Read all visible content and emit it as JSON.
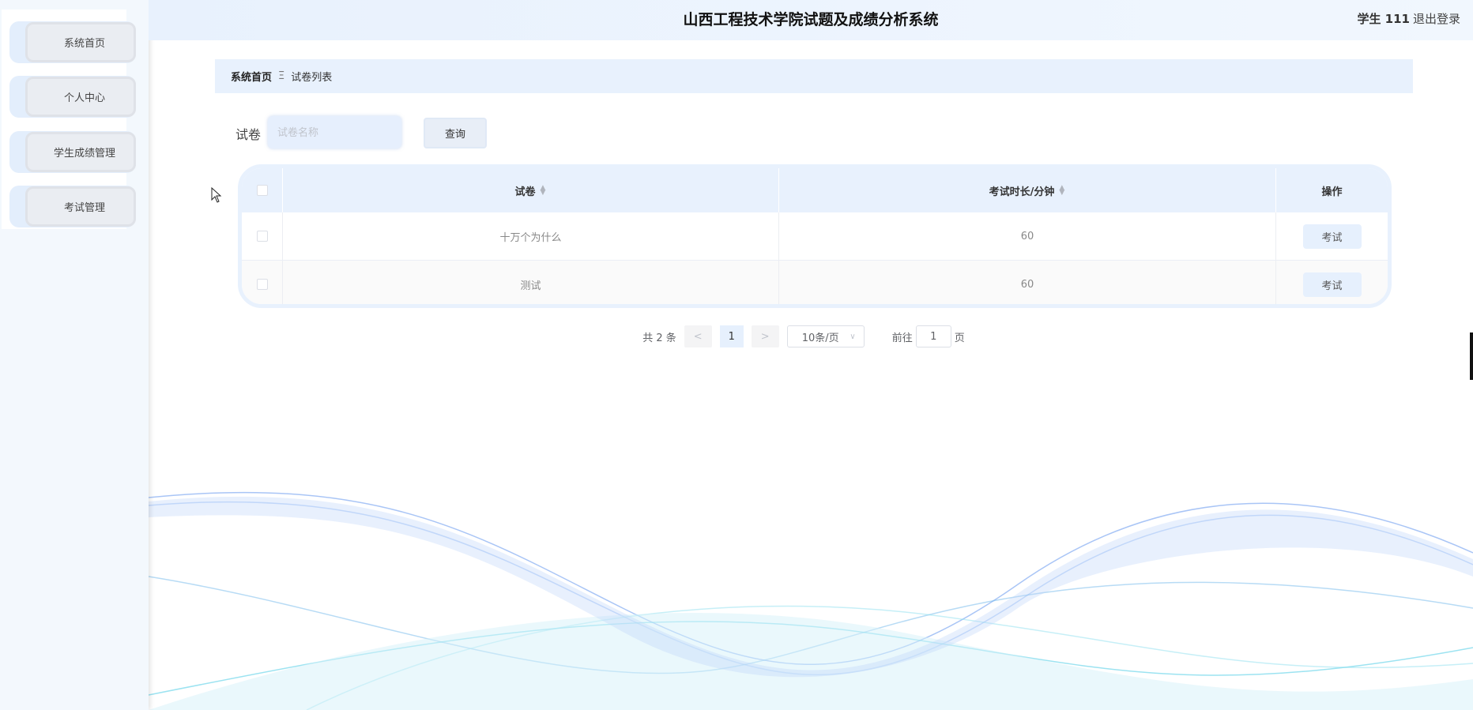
{
  "header": {
    "title": "山西工程技术学院试题及成绩分析系统",
    "user": "学生 111",
    "logout": "退出登录"
  },
  "sidebar": {
    "items": [
      {
        "label": "系统首页"
      },
      {
        "label": "个人中心"
      },
      {
        "label": "学生成绩管理"
      },
      {
        "label": "考试管理"
      }
    ]
  },
  "breadcrumb": {
    "home": "系统首页",
    "separator": "Ξ",
    "current": "试卷列表"
  },
  "search": {
    "label": "试卷",
    "placeholder": "试卷名称",
    "value": "",
    "button": "查询"
  },
  "table": {
    "columns": [
      "试卷",
      "考试时长/分钟",
      "操作"
    ],
    "rows": [
      {
        "name": "十万个为什么",
        "duration": "60",
        "action": "考试"
      },
      {
        "name": "测试",
        "duration": "60",
        "action": "考试"
      }
    ]
  },
  "pagination": {
    "total": "共 2 条",
    "prev": "<",
    "current": "1",
    "next": ">",
    "page_size": "10条/页",
    "goto_label": "前往",
    "goto_value": "1",
    "page_suffix": "页"
  },
  "colors": {
    "accent": "#e8f1fd",
    "sidebar_bg": "#f3f8fd"
  }
}
